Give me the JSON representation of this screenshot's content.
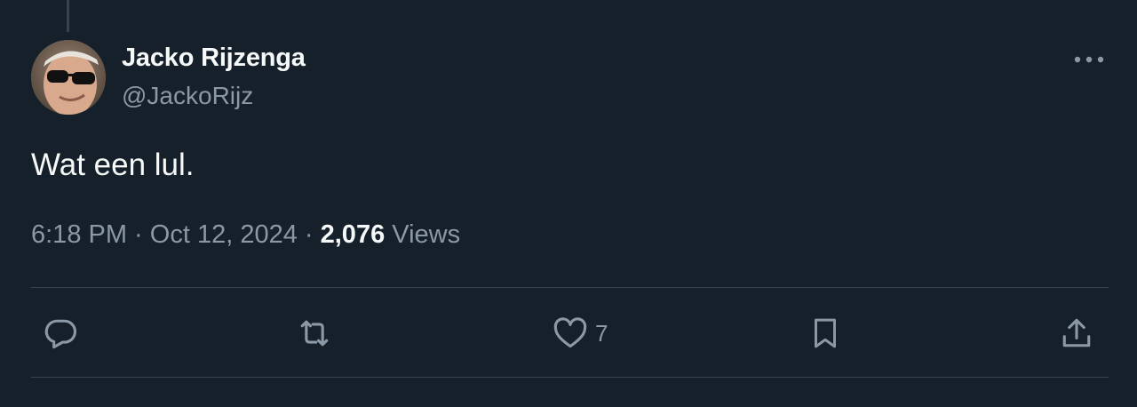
{
  "tweet": {
    "author_name": "Jacko Rijzenga",
    "author_handle": "@JackoRijz",
    "text": "Wat een lul.",
    "time": "6:18 PM",
    "separator": " · ",
    "date": "Oct 12, 2024",
    "views_count": "2,076",
    "views_label": " Views"
  },
  "actions": {
    "reply": {
      "icon": "reply-icon"
    },
    "retweet": {
      "icon": "retweet-icon"
    },
    "like": {
      "icon": "heart-icon",
      "count": "7"
    },
    "bookmark": {
      "icon": "bookmark-icon"
    },
    "share": {
      "icon": "share-icon"
    }
  },
  "colors": {
    "background": "#15202b",
    "primary_text": "#f7f9f9",
    "secondary_text": "#8b98a5",
    "divider": "#38444d"
  }
}
